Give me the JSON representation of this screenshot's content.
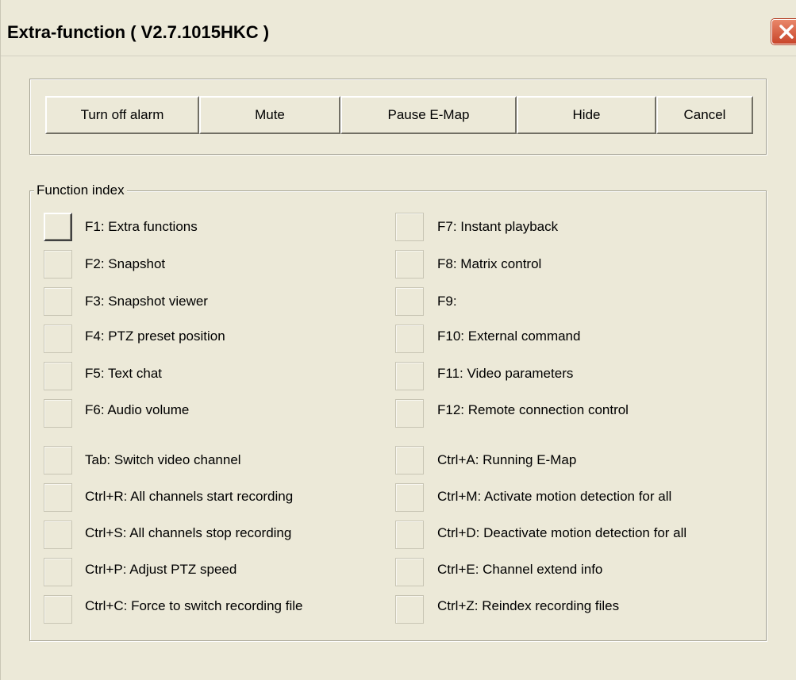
{
  "window": {
    "title": "Extra-function ( V2.7.1015HKC )",
    "close_icon": "close-icon"
  },
  "actions": [
    "Turn off alarm",
    "Mute",
    "Pause E-Map",
    "Hide",
    "Cancel"
  ],
  "function_index": {
    "legend": "Function index",
    "left": [
      "F1: Extra functions",
      "F2: Snapshot",
      "F3: Snapshot viewer",
      "F4: PTZ preset position",
      "F5: Text chat",
      "F6: Audio volume",
      "Tab: Switch video channel",
      "Ctrl+R: All channels start recording",
      "Ctrl+S: All channels stop recording",
      "Ctrl+P: Adjust PTZ speed",
      "Ctrl+C: Force to switch recording file"
    ],
    "right": [
      "F7: Instant playback",
      "F8: Matrix control",
      "F9:",
      "F10: External command",
      "F11: Video parameters",
      "F12: Remote connection control",
      "Ctrl+A: Running E-Map",
      "Ctrl+M: Activate motion detection for all",
      "Ctrl+D: Deactivate motion detection for all",
      "Ctrl+E: Channel extend info",
      "Ctrl+Z: Reindex recording files"
    ]
  },
  "colors": {
    "background": "#ece9d8",
    "close_button": "#c8452a"
  }
}
